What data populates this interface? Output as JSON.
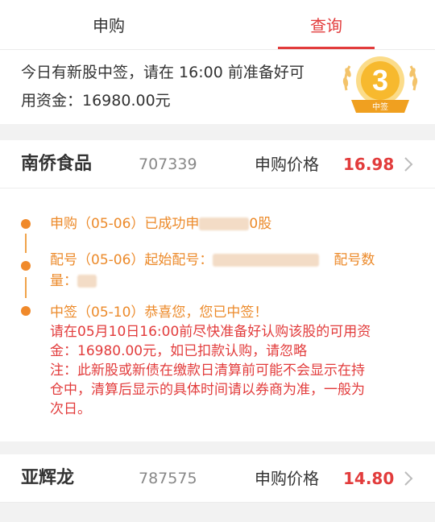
{
  "tabs": [
    {
      "label": "申购",
      "active": false
    },
    {
      "label": "查询",
      "active": true
    }
  ],
  "notice": {
    "line1": "今日有新股中签，请在 16:00 前准备好可",
    "line2": "用资金：16980.00元",
    "badge_number": "3",
    "badge_label": "中签"
  },
  "stocks": [
    {
      "name": "南侨食品",
      "code": "707339",
      "price_label": "申购价格",
      "price": "16.98"
    },
    {
      "name": "亚辉龙",
      "code": "787575",
      "price_label": "申购价格",
      "price": "14.80"
    }
  ],
  "timeline": {
    "entry1": {
      "prefix": "申购（05-06）已成功申",
      "suffix": "0股"
    },
    "entry2": {
      "prefix": "配号（05-06）起始配号：",
      "suffix": "配号数",
      "line2": "量："
    },
    "entry3": {
      "line1": "中签（05-10）恭喜您，您已中签！",
      "line2": "请在05月10日16:00前尽快准备好认购该股的可用资",
      "line3": "金：16980.00元，如已扣款认购，请忽略",
      "line4": "注：此新股或新债在缴款日清算前可能不会显示在持",
      "line5": "仓中，清算后显示的具体时间请以券商为准，一般为",
      "line6": "次日。"
    }
  },
  "colors": {
    "accent": "#e23c3c",
    "orange": "#ec8a2a",
    "divider": "#f2f2f2"
  }
}
